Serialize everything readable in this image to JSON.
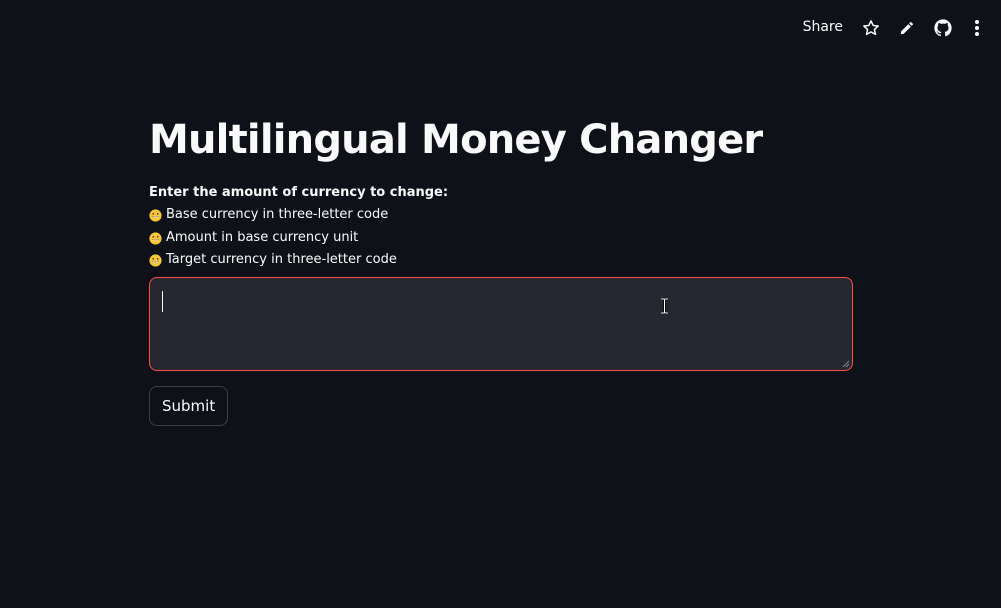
{
  "toolbar": {
    "share_label": "Share",
    "icons": [
      "star-icon",
      "pencil-icon",
      "github-icon",
      "more-vertical-icon"
    ]
  },
  "page": {
    "title": "Multilingual Money Changer",
    "instructions": {
      "lead": "Enter the amount of currency to change:",
      "bullets": [
        "Base currency in three-letter code",
        "Amount in base currency unit",
        "Target currency in three-letter code"
      ],
      "bullet_icon": "grinning-face-emoji"
    },
    "input": {
      "value": "",
      "placeholder": ""
    },
    "submit_label": "Submit"
  },
  "colors": {
    "background": "#0e1117",
    "text": "#fafafa",
    "input_bg": "#262730",
    "focus_border": "#ff4b4b"
  }
}
